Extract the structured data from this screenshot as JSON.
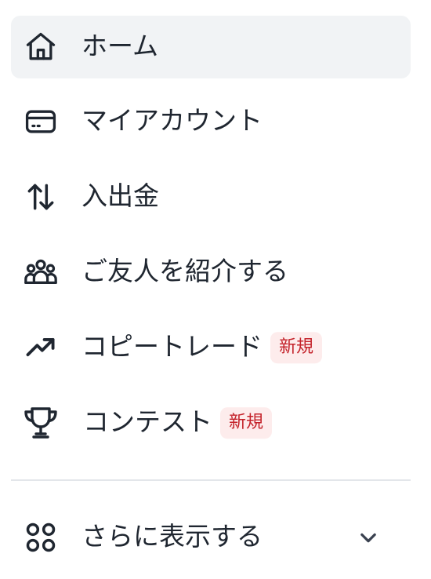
{
  "nav": {
    "items": [
      {
        "label": "ホーム",
        "icon": "home-icon",
        "active": true
      },
      {
        "label": "マイアカウント",
        "icon": "wallet-card-icon"
      },
      {
        "label": "入出金",
        "icon": "transfer-arrows-icon"
      },
      {
        "label": "ご友人を紹介する",
        "icon": "users-group-icon"
      },
      {
        "label": "コピートレード",
        "icon": "trending-up-icon",
        "badge": "新規"
      },
      {
        "label": "コンテスト",
        "icon": "trophy-icon",
        "badge": "新規"
      }
    ],
    "more": {
      "label": "さらに表示する",
      "icon": "grid-dots-icon",
      "chevron": "chevron-down-icon"
    }
  },
  "colors": {
    "text": "#1f2630",
    "active_bg": "#f1f3f5",
    "badge_bg": "#fdecec",
    "badge_text": "#c4222a",
    "divider": "#e3e6ea"
  }
}
